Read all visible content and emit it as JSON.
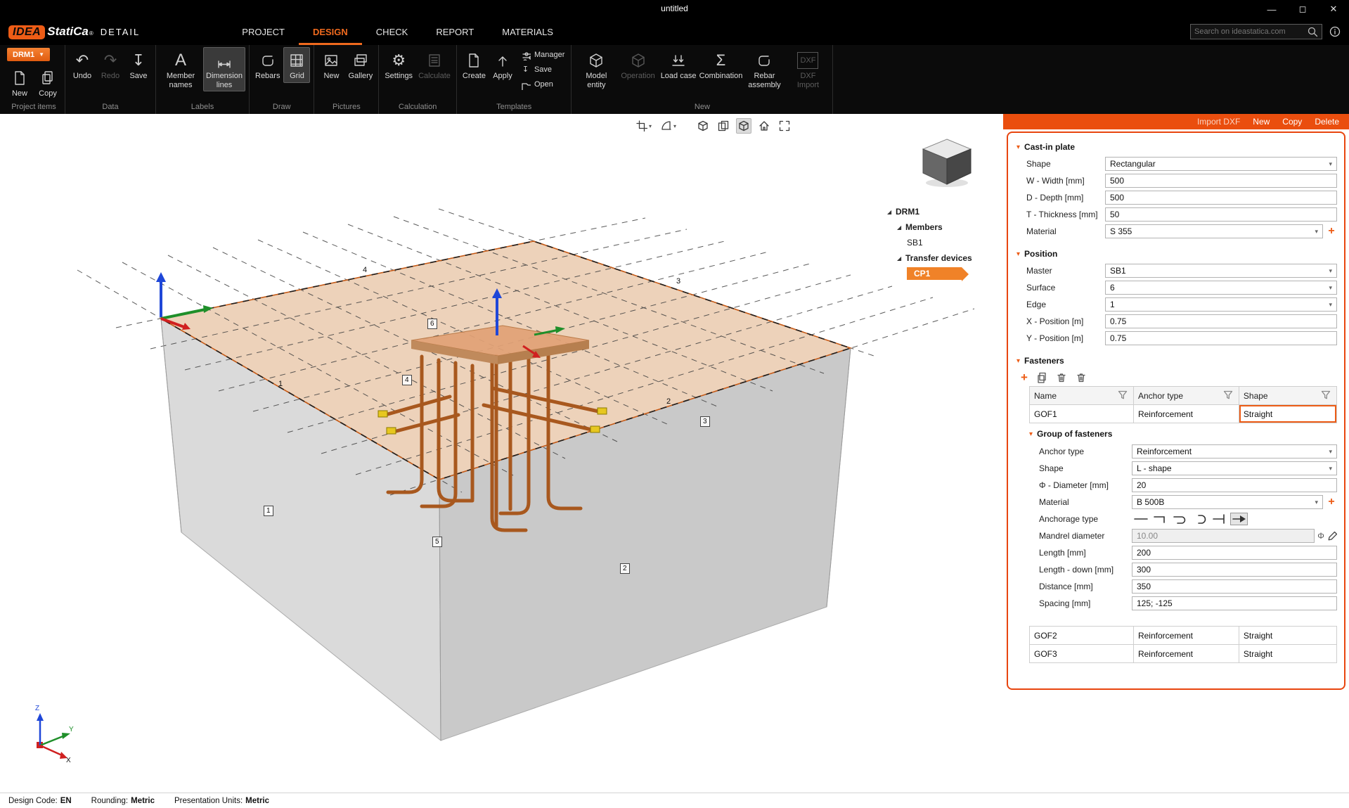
{
  "titlebar": {
    "title": "untitled"
  },
  "menubar": {
    "logo_idea": "IDEA",
    "logo_statica": "StatiCa",
    "logo_reg": "®",
    "logo_product": "DETAIL",
    "tabs": [
      {
        "label": "PROJECT"
      },
      {
        "label": "DESIGN"
      },
      {
        "label": "CHECK"
      },
      {
        "label": "REPORT"
      },
      {
        "label": "MATERIALS"
      }
    ],
    "search_placeholder": "Search on ideastatica.com"
  },
  "ribbon": {
    "project_items": {
      "label": "Project items",
      "selector": "DRM1",
      "new": "New",
      "copy": "Copy"
    },
    "data": {
      "label": "Data",
      "undo": "Undo",
      "redo": "Redo",
      "save": "Save"
    },
    "labels": {
      "label": "Labels",
      "member_names": "Member names",
      "dimension_lines": "Dimension lines"
    },
    "draw": {
      "label": "Draw",
      "rebars": "Rebars",
      "grid": "Grid"
    },
    "pictures": {
      "label": "Pictures",
      "new": "New",
      "gallery": "Gallery"
    },
    "calculation": {
      "label": "Calculation",
      "settings": "Settings",
      "calculate": "Calculate"
    },
    "templates": {
      "label": "Templates",
      "create": "Create",
      "apply": "Apply",
      "manager": "Manager",
      "save": "Save",
      "open": "Open"
    },
    "new_entities": {
      "label": "New",
      "model_entity": "Model entity",
      "operation": "Operation",
      "load_case": "Load case",
      "combination": "Combination",
      "rebar_assembly": "Rebar assembly",
      "dxf_import": "DXF Import"
    }
  },
  "viewport": {
    "tree": {
      "root": "DRM1",
      "members": "Members",
      "sb1": "SB1",
      "transfer_devices": "Transfer devices",
      "cp1": "CP1"
    },
    "axis": {
      "x": "X",
      "y": "Y",
      "z": "Z"
    },
    "scene_labels": [
      {
        "text": "4"
      },
      {
        "text": "3"
      },
      {
        "text": "1"
      },
      {
        "text": "2"
      },
      {
        "text": "6"
      },
      {
        "text": "4"
      },
      {
        "text": "3"
      },
      {
        "text": "1"
      },
      {
        "text": "5"
      },
      {
        "text": "2"
      }
    ]
  },
  "panel": {
    "toolbar": {
      "import_dxf": "Import DXF",
      "new": "New",
      "copy": "Copy",
      "delete": "Delete"
    },
    "cast_in_plate": {
      "title": "Cast-in plate",
      "shape_label": "Shape",
      "shape_value": "Rectangular",
      "width_label": "W - Width [mm]",
      "width_value": "500",
      "depth_label": "D - Depth [mm]",
      "depth_value": "500",
      "thickness_label": "T - Thickness [mm]",
      "thickness_value": "50",
      "material_label": "Material",
      "material_value": "S 355"
    },
    "position": {
      "title": "Position",
      "master_label": "Master",
      "master_value": "SB1",
      "surface_label": "Surface",
      "surface_value": "6",
      "edge_label": "Edge",
      "edge_value": "1",
      "x_label": "X - Position [m]",
      "x_value": "0.75",
      "y_label": "Y - Position [m]",
      "y_value": "0.75"
    },
    "fasteners": {
      "title": "Fasteners",
      "headers": [
        "Name",
        "Anchor type",
        "Shape"
      ],
      "rows": [
        {
          "name": "GOF1",
          "anchor_type": "Reinforcement",
          "shape": "Straight"
        },
        {
          "name": "GOF2",
          "anchor_type": "Reinforcement",
          "shape": "Straight"
        },
        {
          "name": "GOF3",
          "anchor_type": "Reinforcement",
          "shape": "Straight"
        }
      ],
      "group": {
        "title": "Group of fasteners",
        "anchor_type_label": "Anchor type",
        "anchor_type_value": "Reinforcement",
        "shape_label": "Shape",
        "shape_value": "L - shape",
        "diameter_label": "Φ - Diameter [mm]",
        "diameter_value": "20",
        "material_label": "Material",
        "material_value": "B 500B",
        "anchorage_label": "Anchorage type",
        "mandrel_label": "Mandrel diameter",
        "mandrel_value": "10.00",
        "phi": "Φ",
        "length_label": "Length [mm]",
        "length_value": "200",
        "length_down_label": "Length - down [mm]",
        "length_down_value": "300",
        "distance_label": "Distance [mm]",
        "distance_value": "350",
        "spacing_label": "Spacing [mm]",
        "spacing_value": "125; -125"
      }
    }
  },
  "statusbar": {
    "design_code_label": "Design Code:",
    "design_code_value": "EN",
    "rounding_label": "Rounding:",
    "rounding_value": "Metric",
    "units_label": "Presentation Units:",
    "units_value": "Metric"
  },
  "colors": {
    "accent": "#ED5C16",
    "panel_border": "#E8450F",
    "strip": "#EA4E0E",
    "highlight": "#F08228"
  }
}
